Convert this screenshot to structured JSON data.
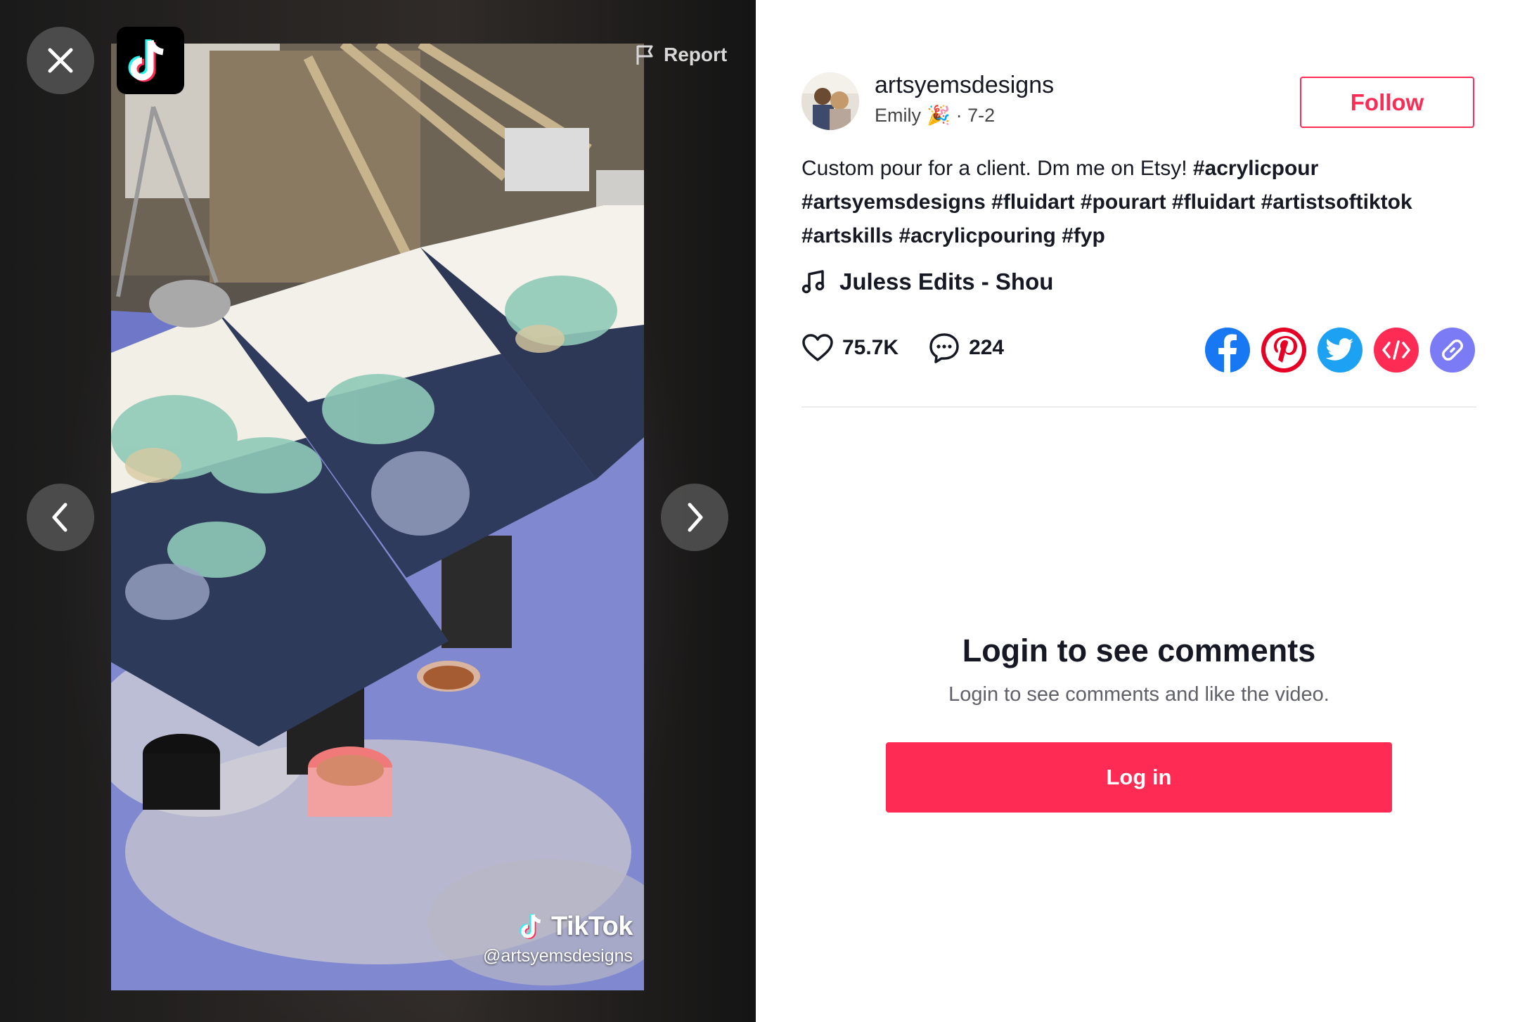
{
  "video": {
    "report_label": "Report",
    "watermark_brand": "TikTok",
    "watermark_handle": "@artsyemsdesigns"
  },
  "author": {
    "username": "artsyemsdesigns",
    "display_name": "Emily",
    "display_name_emoji": "🎉",
    "date": "· 7-2",
    "follow_label": "Follow"
  },
  "caption": {
    "text": "Custom pour for a client. Dm me on Etsy! ",
    "hashtags": [
      "#acrylicpour",
      "#artsyemsdesigns",
      "#fluidart",
      "#pourart",
      "#fluidart",
      "#artistsoftiktok",
      "#artskills",
      "#acrylicpouring",
      "#fyp"
    ]
  },
  "music": {
    "title": "Juless Edits - Shou"
  },
  "stats": {
    "likes": "75.7K",
    "comments": "224"
  },
  "share": {
    "icons": [
      "facebook-icon",
      "pinterest-icon",
      "twitter-icon",
      "embed-icon",
      "link-icon"
    ],
    "colors": {
      "facebook": "#1877f2",
      "pinterest": "#e60023",
      "twitter": "#1da1f2",
      "embed": "#fe2c55",
      "link": "#7b7bf5"
    }
  },
  "comments_gate": {
    "title": "Login to see comments",
    "subtitle": "Login to see comments and like the video.",
    "login_label": "Log in"
  },
  "colors": {
    "accent": "#fe2c55",
    "text": "#161823"
  }
}
